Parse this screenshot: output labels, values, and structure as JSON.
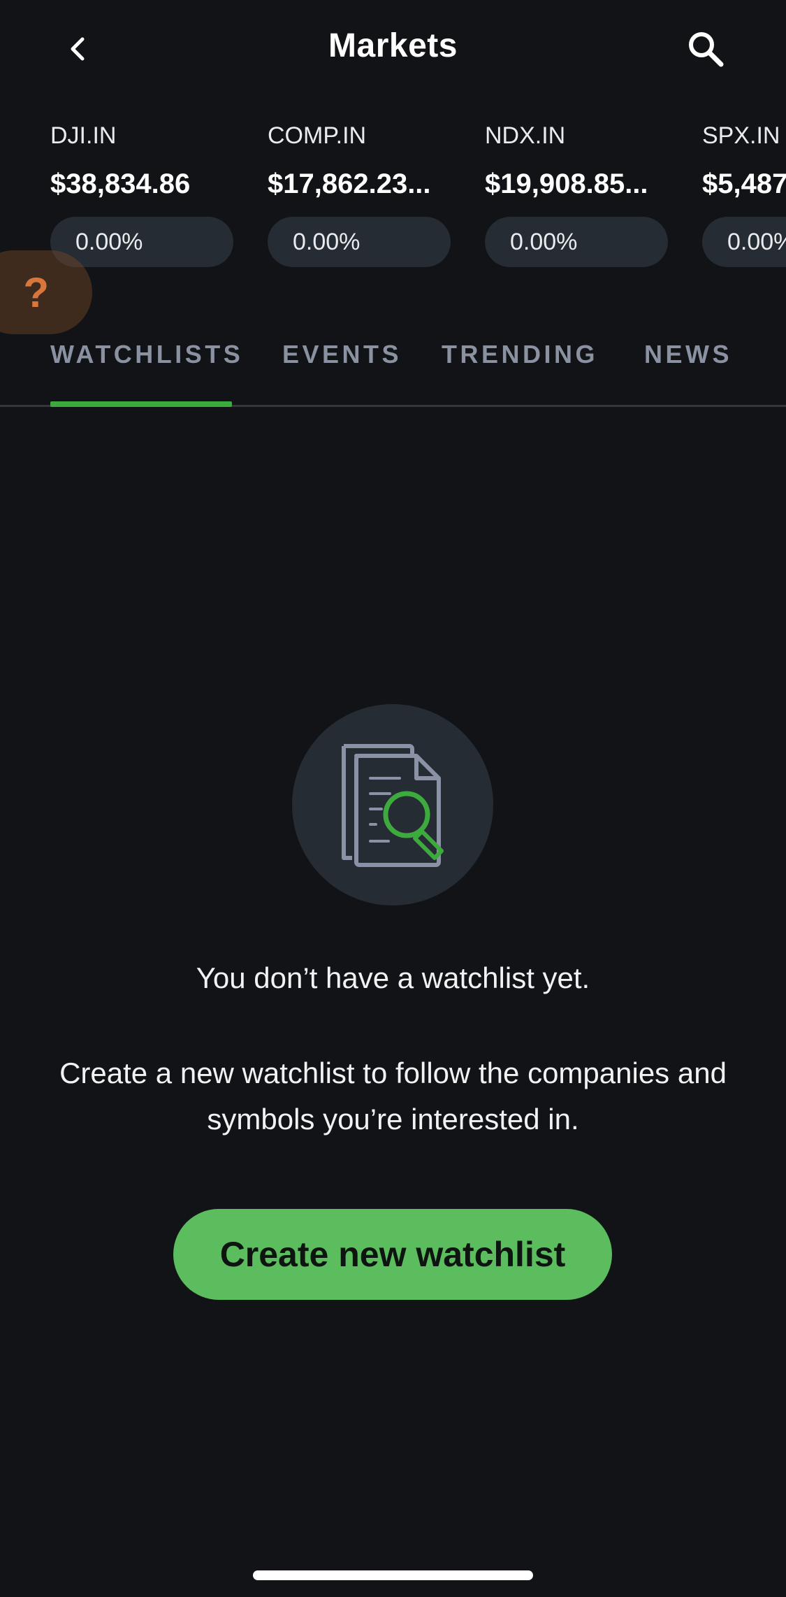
{
  "header": {
    "title": "Markets",
    "back_icon": "chevron-left-icon",
    "search_icon": "search-icon"
  },
  "tickers": [
    {
      "symbol": "DJI.IN",
      "price": "$38,834.86",
      "change": "0.00%"
    },
    {
      "symbol": "COMP.IN",
      "price": "$17,862.23...",
      "change": "0.00%"
    },
    {
      "symbol": "NDX.IN",
      "price": "$19,908.85...",
      "change": "0.00%"
    },
    {
      "symbol": "SPX.IN",
      "price": "$5,487",
      "change": "0.00%"
    }
  ],
  "help": {
    "label": "?"
  },
  "tabs": [
    {
      "label": "WATCHLISTS",
      "active": true
    },
    {
      "label": "EVENTS",
      "active": false
    },
    {
      "label": "TRENDING",
      "active": false
    },
    {
      "label": "NEWS",
      "active": false
    }
  ],
  "empty_state": {
    "icon": "document-search-icon",
    "title": "You don’t have a watchlist yet.",
    "description": "Create a new watchlist to follow the companies and symbols you’re interested in.",
    "button_label": "Create new watchlist"
  },
  "colors": {
    "background": "#121317",
    "accent_green": "#5bbd5d",
    "tab_underline": "#3daa3d",
    "pill_bg": "#262c33",
    "help_orange": "#d9773a"
  }
}
